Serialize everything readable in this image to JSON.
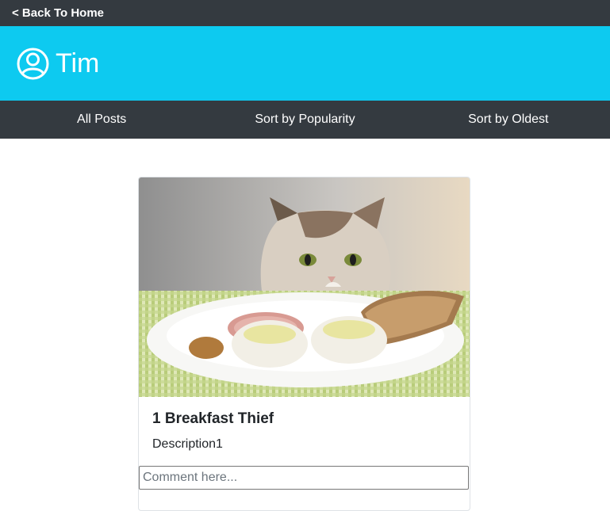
{
  "topbar": {
    "back_label": "< Back To Home"
  },
  "header": {
    "icon": "user-circle-icon",
    "username": "Tim",
    "color": "#0dcaf0"
  },
  "nav": {
    "items": [
      {
        "label": "All Posts"
      },
      {
        "label": "Sort by Popularity"
      },
      {
        "label": "Sort by Oldest"
      }
    ]
  },
  "post": {
    "title": "1 Breakfast Thief",
    "description": "Description1",
    "comment_placeholder": "Comment here...",
    "comment_value": ""
  },
  "colors": {
    "dark_bar": "#343a40",
    "accent": "#0dcaf0"
  }
}
